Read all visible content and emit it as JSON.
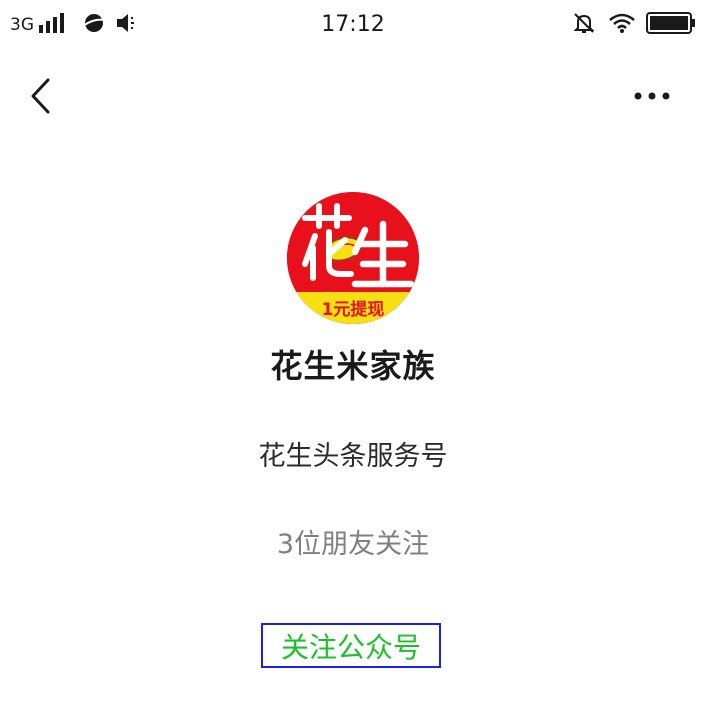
{
  "status_bar": {
    "network": "3G",
    "time": "17:12",
    "icons": [
      "signal-icon",
      "globe-icon",
      "speaker-icon",
      "mute-bell-icon",
      "wifi-icon",
      "battery-icon"
    ]
  },
  "nav": {
    "back_icon": "back-chevron-icon",
    "more_icon": "more-dots-icon"
  },
  "profile": {
    "avatar_text_main": "花生",
    "avatar_text_banner": "1元提现",
    "name": "花生米家族",
    "description": "花生头条服务号",
    "friends_following": "3位朋友关注",
    "follow_button_label": "关注公众号"
  },
  "colors": {
    "follow_text": "#1fbf2a",
    "follow_border": "#1a22e8",
    "avatar_bg": "#e8101a",
    "avatar_banner": "#f5e013"
  }
}
